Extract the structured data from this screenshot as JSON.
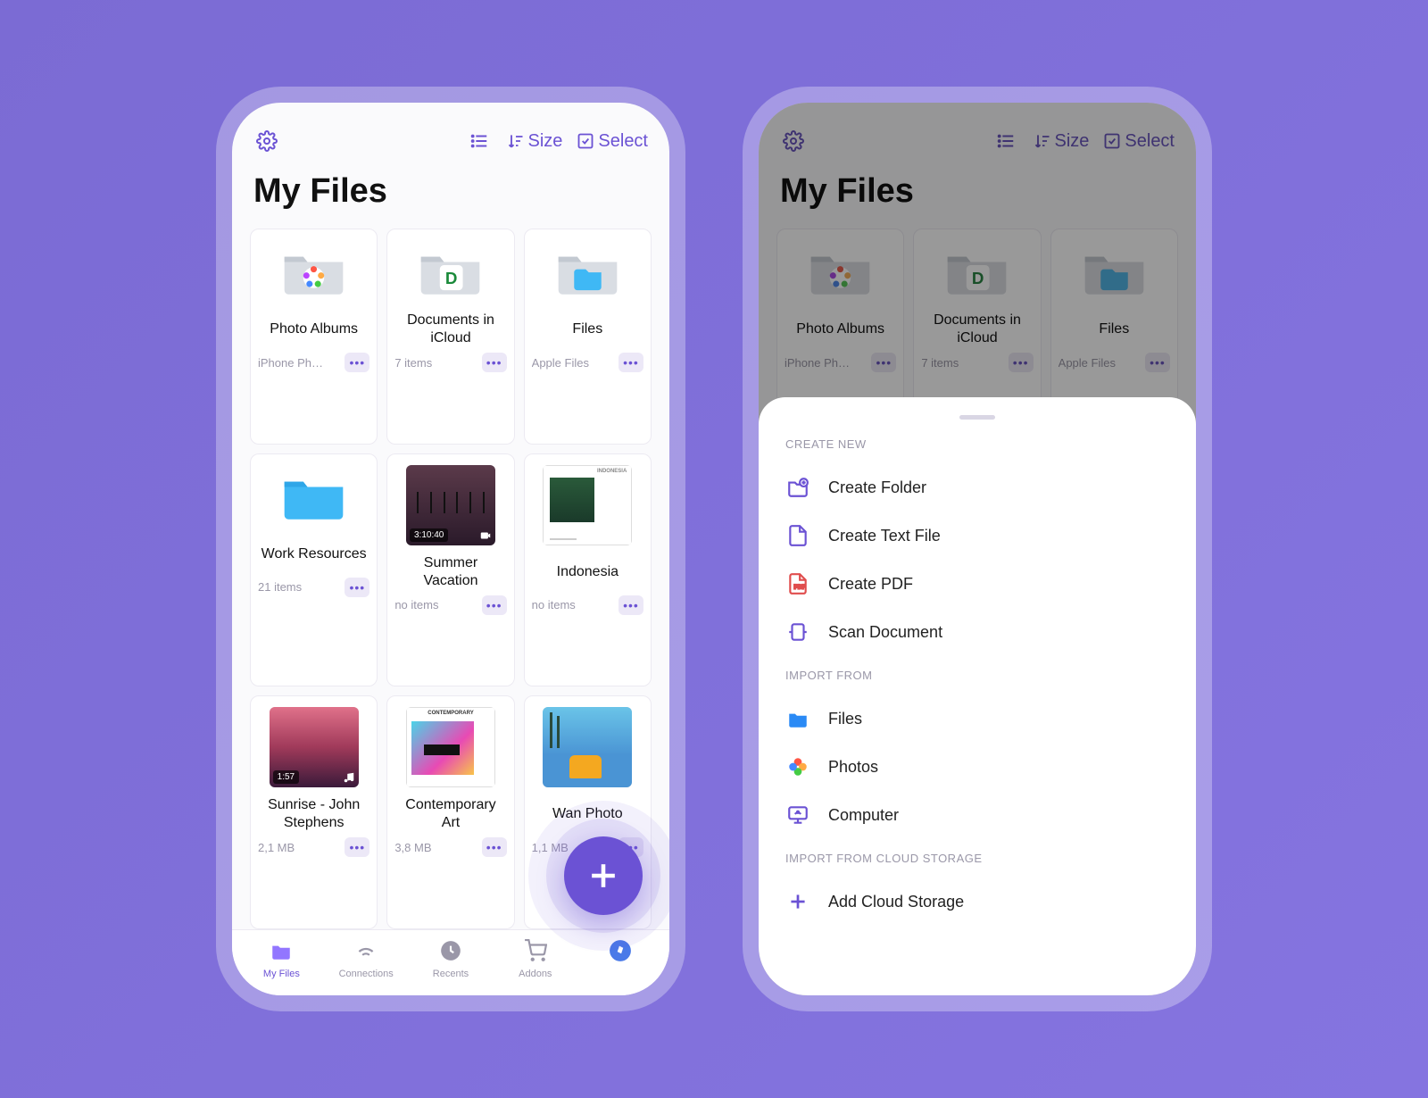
{
  "header": {
    "title": "My Files",
    "sort_label": "Size",
    "select_label": "Select"
  },
  "tiles": [
    {
      "name": "Photo Albums",
      "meta": "iPhone Ph…",
      "icon": "folder-photos"
    },
    {
      "name": "Documents in iCloud",
      "meta": "7 items",
      "icon": "folder-documents"
    },
    {
      "name": "Files",
      "meta": "Apple Files",
      "icon": "folder-files"
    },
    {
      "name": "Work Resources",
      "meta": "21 items",
      "icon": "folder-plain"
    },
    {
      "name": "Summer Vacation",
      "meta": "no items",
      "icon": "thumb-video",
      "badge": "3:10:40"
    },
    {
      "name": "Indonesia",
      "meta": "no items",
      "icon": "thumb-doc",
      "doclabel": "INDONESIA"
    },
    {
      "name": "Sunrise - John Stephens",
      "meta": "2,1 MB",
      "icon": "thumb-audio",
      "badge": "1:57"
    },
    {
      "name": "Contemporary Art",
      "meta": "3,8 MB",
      "icon": "thumb-art",
      "doclabel": "CONTEMPORARY"
    },
    {
      "name": "Wan Photo",
      "meta": "1,1 MB",
      "icon": "thumb-photo"
    }
  ],
  "tabs": [
    {
      "label": "My Files"
    },
    {
      "label": "Connections"
    },
    {
      "label": "Recents"
    },
    {
      "label": "Addons"
    }
  ],
  "sheet": {
    "section1": "CREATE NEW",
    "items1": [
      {
        "label": "Create Folder",
        "icon": "folder-plus",
        "color": "#6b52d4"
      },
      {
        "label": "Create Text File",
        "icon": "file",
        "color": "#6b52d4"
      },
      {
        "label": "Create PDF",
        "icon": "pdf",
        "color": "#e04d4d"
      },
      {
        "label": "Scan Document",
        "icon": "scan",
        "color": "#6b52d4"
      }
    ],
    "section2": "IMPORT FROM",
    "items2": [
      {
        "label": "Files",
        "icon": "files-app"
      },
      {
        "label": "Photos",
        "icon": "photos-app"
      },
      {
        "label": "Computer",
        "icon": "computer"
      }
    ],
    "section3": "IMPORT FROM CLOUD STORAGE",
    "items3": [
      {
        "label": "Add Cloud Storage",
        "icon": "plus",
        "color": "#6b52d4"
      }
    ]
  }
}
